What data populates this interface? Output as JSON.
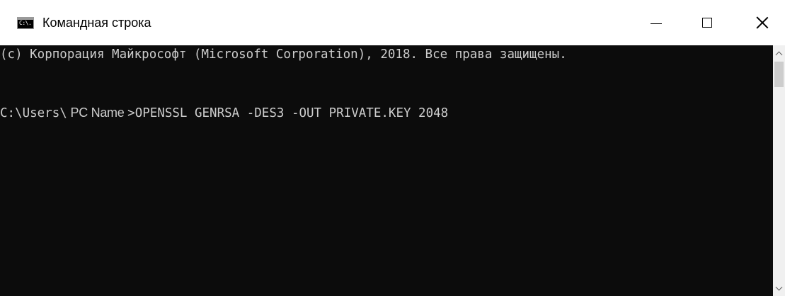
{
  "window": {
    "title": "Командная строка",
    "icon": "cmd-icon",
    "icon_text": "C:\\."
  },
  "controls": {
    "minimize_icon": "minimize-icon",
    "maximize_icon": "maximize-icon",
    "close_icon": "close-icon"
  },
  "console": {
    "line1": "(c) Корпорация Майкрософт (Microsoft Corporation), 2018. Все права защищены.",
    "line2_prefix": "C:\\Users\\",
    "line2_pcname": " PC Name ",
    "line2_command": ">OPENSSL GENRSA -DES3 -OUT PRIVATE.KEY 2048",
    "background_color": "#0c0c0c",
    "text_color": "#cccccc"
  },
  "scrollbar": {
    "up_icon": "chevron-up-icon",
    "down_icon": "chevron-down-icon"
  }
}
